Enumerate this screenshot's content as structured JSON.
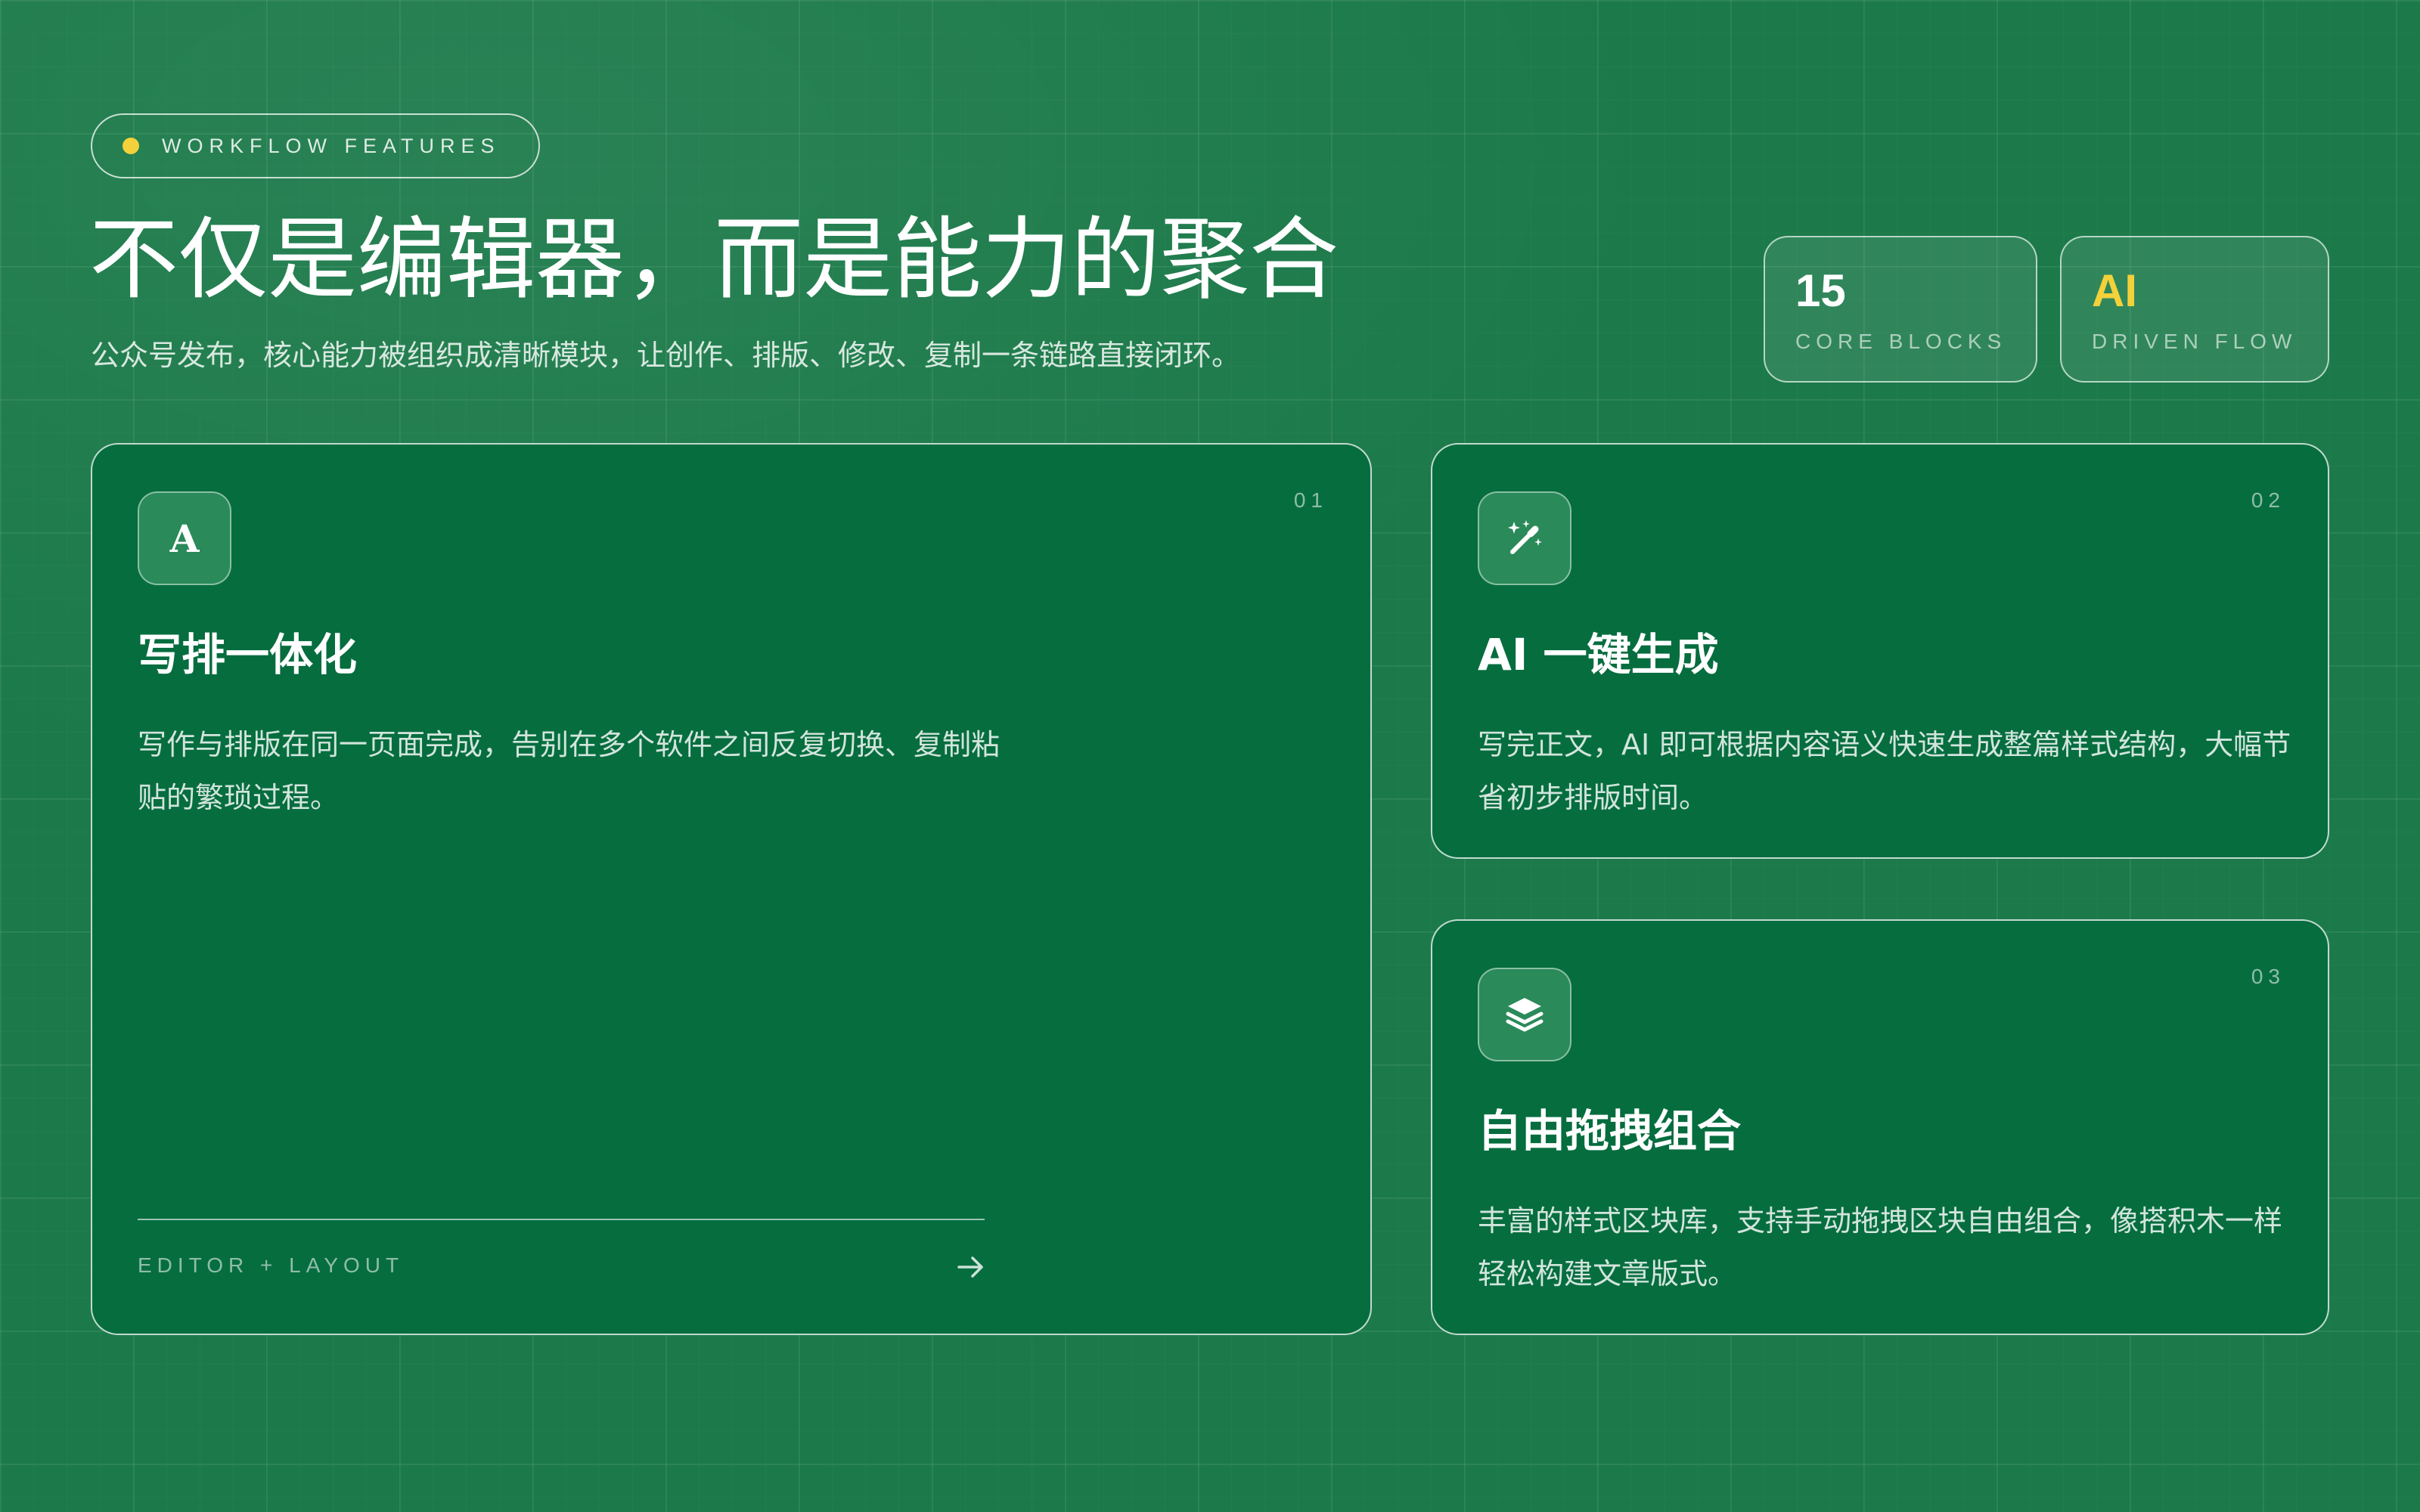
{
  "header": {
    "eyebrow": "WORKFLOW FEATURES",
    "title": "不仅是编辑器，而是能力的聚合",
    "subtitle": "公众号发布，核心能力被组织成清晰模块，让创作、排版、修改、复制一条链路直接闭环。"
  },
  "stats": [
    {
      "value": "15",
      "label": "CORE BLOCKS",
      "color": "#ffffff"
    },
    {
      "value": "AI",
      "label": "DRIVEN FLOW",
      "color": "#f2d13a"
    }
  ],
  "cards": [
    {
      "number": "01",
      "icon": "A",
      "icon_name": "typography-icon",
      "title": "写排一体化",
      "description": "写作与排版在同一页面完成，告别在多个软件之间反复切换、复制粘贴的繁琐过程。",
      "footer": "EDITOR + LAYOUT"
    },
    {
      "number": "02",
      "icon_name": "magic-wand-icon",
      "title": "AI 一键生成",
      "description": "写完正文，AI 即可根据内容语义快速生成整篇样式结构，大幅节省初步排版时间。"
    },
    {
      "number": "03",
      "icon_name": "layers-icon",
      "title": "自由拖拽组合",
      "description": "丰富的样式区块库，支持手动拖拽区块自由组合，像搭积木一样轻松构建文章版式。"
    }
  ],
  "colors": {
    "background": "#1c7a4a",
    "card": "#066d3f",
    "accent": "#f2d13a"
  }
}
